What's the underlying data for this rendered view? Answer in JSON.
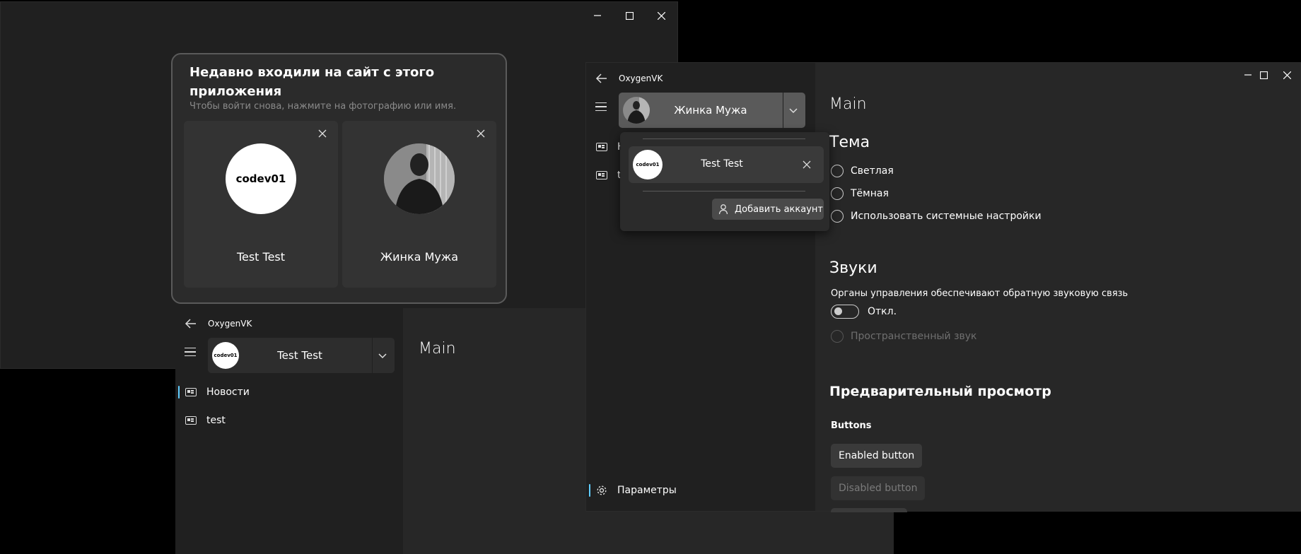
{
  "login_window": {
    "dialog": {
      "title": "Недавно входили на сайт с этого приложения",
      "subtitle": "Чтобы войти снова, нажмите на фотографию или имя.",
      "accounts": [
        {
          "name": "Test Test",
          "avatar_text": "codev01"
        },
        {
          "name": "Жинка Мужа",
          "avatar_text": ""
        }
      ]
    }
  },
  "main_window": {
    "app_name": "OxygenVK",
    "account": {
      "name": "Test Test",
      "avatar_text": "codev01"
    },
    "nav": [
      {
        "label": "Новости",
        "icon": "news-icon"
      },
      {
        "label": "test",
        "icon": "news-icon"
      }
    ],
    "page_title": "Main"
  },
  "settings_window": {
    "app_name": "OxygenVK",
    "account": {
      "name": "Жинка Мужа"
    },
    "flyout": {
      "account": {
        "name": "Test Test",
        "avatar_text": "codev01"
      },
      "add_account_label": "Добавить аккаунт"
    },
    "nav": [
      {
        "label": "Н",
        "icon": "news-icon"
      },
      {
        "label": "t",
        "icon": "news-icon"
      }
    ],
    "settings_label": "Параметры",
    "page_title": "Main",
    "theme": {
      "heading": "Тема",
      "options": [
        "Светлая",
        "Тёмная",
        "Использовать системные настройки"
      ]
    },
    "sounds": {
      "heading": "Звуки",
      "description": "Органы управления обеспечивают обратную звуковую связь",
      "toggle_state": "Откл.",
      "spatial_label": "Пространственный звук"
    },
    "preview": {
      "heading": "Предварительный просмотр",
      "buttons_heading": "Buttons",
      "enabled_button": "Enabled button",
      "disabled_button": "Disabled button"
    }
  },
  "colors": {
    "window_bg": "#202020",
    "content_bg": "#272727",
    "accent": "#60cdff"
  }
}
